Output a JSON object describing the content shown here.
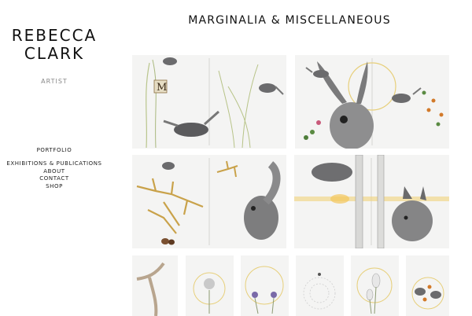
{
  "site": {
    "name_line1": "REBECCA",
    "name_line2": "CLARK",
    "tagline": "ARTIST"
  },
  "nav": {
    "items": [
      {
        "label": "PORTFOLIO"
      },
      {
        "label": "EXHIBITIONS & PUBLICATIONS"
      },
      {
        "label": "ABOUT"
      },
      {
        "label": "CONTACT"
      },
      {
        "label": "SHOP"
      }
    ]
  },
  "gallery": {
    "title": "MARGINALIA & MISCELLANEOUS",
    "artworks": [
      {
        "subject": "wrens-and-grasses"
      },
      {
        "subject": "hare-and-birds"
      },
      {
        "subject": "squirrel-and-thorns"
      },
      {
        "subject": "owl-fox-birches"
      },
      {
        "subject": "branch-study"
      },
      {
        "subject": "dandelion-circle"
      },
      {
        "subject": "violets-circle"
      },
      {
        "subject": "cobweb-circle"
      },
      {
        "subject": "snowdrops-circle"
      },
      {
        "subject": "birds-circle"
      }
    ]
  },
  "colors": {
    "background": "#ffffff",
    "text": "#222222",
    "muted": "#888888",
    "gold": "#c9a24a",
    "paper": "#f3f3f2"
  }
}
